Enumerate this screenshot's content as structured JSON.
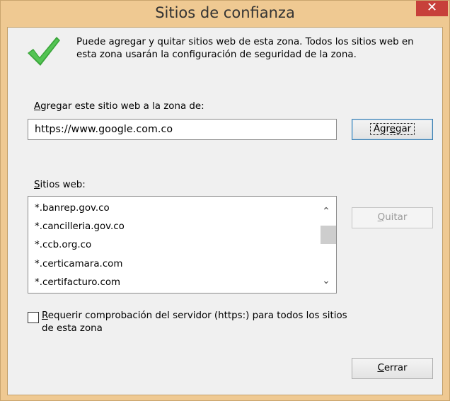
{
  "window": {
    "title": "Sitios de confianza",
    "close_glyph": "✕"
  },
  "info": {
    "icon": "checkmark-icon",
    "text": "Puede agregar y quitar sitios web de esta zona. Todos los sitios web en esta zona usarán la configuración de seguridad de la zona."
  },
  "add": {
    "label_mnemonic": "A",
    "label_rest": "gregar este sitio web a la zona de:",
    "input_value": "https://www.google.com.co",
    "button_pre": "Agr",
    "button_mnemonic": "e",
    "button_post": "gar"
  },
  "sites": {
    "label_mnemonic": "S",
    "label_rest": "itios web:",
    "items": [
      "*.banrep.gov.co",
      "*.cancilleria.gov.co",
      "*.ccb.org.co",
      "*.certicamara.com",
      "*.certifacturo.com"
    ],
    "remove_mnemonic": "Q",
    "remove_rest": "uitar"
  },
  "https_check": {
    "checked": false,
    "label_mnemonic": "R",
    "label_rest_line1": "equerir comprobación del servidor (https:) para todos los sitios",
    "label_line2": "de esta zona"
  },
  "close_button": {
    "mnemonic": "C",
    "rest": "errar"
  },
  "colors": {
    "frame": "#efc992",
    "close": "#c7403a",
    "check_green": "#3aa53a"
  }
}
